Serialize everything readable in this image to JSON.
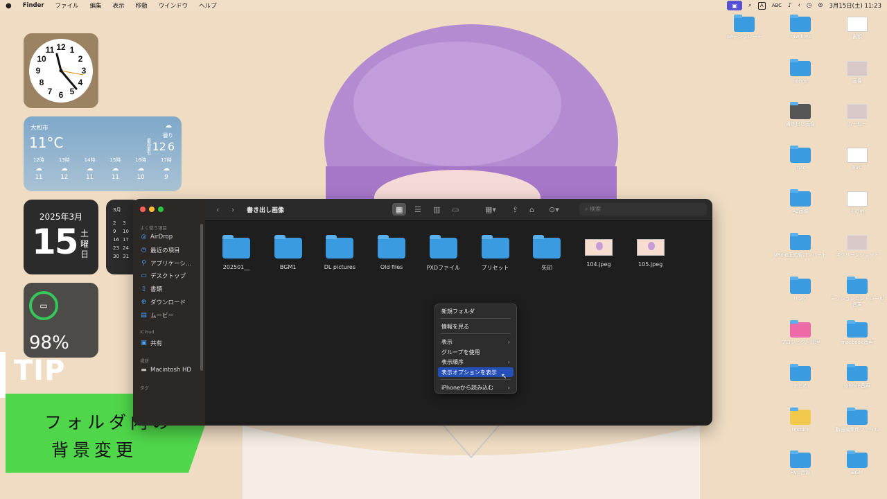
{
  "menubar": {
    "apple": "",
    "items": [
      "Finder",
      "ファイル",
      "編集",
      "表示",
      "移動",
      "ウインドウ",
      "ヘルプ"
    ],
    "input_letter": "A",
    "input_mode": "ABC",
    "datetime": "3月15日(土)  11:23"
  },
  "weather": {
    "city": "大和市",
    "temp": "11°C",
    "condition": "曇り",
    "high_low_label": "最高最低",
    "high": "12",
    "low": "6",
    "hours": [
      {
        "time": "12時",
        "temp": "11"
      },
      {
        "time": "13時",
        "temp": "12"
      },
      {
        "time": "14時",
        "temp": "11"
      },
      {
        "time": "15時",
        "temp": "11"
      },
      {
        "time": "16時",
        "temp": "10"
      },
      {
        "time": "17時",
        "temp": "9"
      }
    ]
  },
  "date_widget": {
    "year_month": "2025年3月",
    "day": "15",
    "weekday": "土曜日"
  },
  "calendar_widget": {
    "month": "3月",
    "days": [
      "2",
      "3",
      "9",
      "10",
      "16",
      "17",
      "23",
      "24",
      "30",
      "31"
    ]
  },
  "battery": {
    "percent": "98%",
    "level": 0.98
  },
  "tip": {
    "label": "TIP",
    "line1": "フォルダ内の",
    "line2": "背景変更"
  },
  "desktop_icons": [
    {
      "label": "Aeテンプレート",
      "kind": "folder"
    },
    {
      "label": "raw files",
      "kind": "folder"
    },
    {
      "label": "書類",
      "kind": "doc"
    },
    {
      "label": "songs",
      "kind": "folder"
    },
    {
      "label": "画像",
      "kind": "image"
    },
    {
      "label": "書き出し画像",
      "kind": "folder-dark"
    },
    {
      "label": "ムービー",
      "kind": "image"
    },
    {
      "label": "mac",
      "kind": "folder"
    },
    {
      "label": "RVC",
      "kind": "doc"
    },
    {
      "label": "AC画像",
      "kind": "folder"
    },
    {
      "label": "その他",
      "kind": "doc"
    },
    {
      "label": "VRoid正式版コンバート",
      "kind": "folder"
    },
    {
      "label": "スクリーンショット",
      "kind": "image"
    },
    {
      "label": "リンク",
      "kind": "folder"
    },
    {
      "label": "ミッションコントロール音声",
      "kind": "folder"
    },
    {
      "label": "プロジェクト管理",
      "kind": "folder-pink"
    },
    {
      "label": "macbook音声",
      "kind": "folder"
    },
    {
      "label": "まとめ",
      "kind": "folder"
    },
    {
      "label": "iphone音声",
      "kind": "folder"
    },
    {
      "label": "texture",
      "kind": "folder-yellow"
    },
    {
      "label": "動画編集用ファイル",
      "kind": "folder"
    },
    {
      "label": "RVC音源",
      "kind": "folder"
    },
    {
      "label": "BGM",
      "kind": "folder"
    }
  ],
  "finder": {
    "title": "書き出し画像",
    "search_placeholder": "検索",
    "sidebar": {
      "favorites_header": "よく使う項目",
      "favorites": [
        {
          "label": "AirDrop",
          "icon": "airdrop-icon"
        },
        {
          "label": "最近の項目",
          "icon": "clock-icon"
        },
        {
          "label": "アプリケーシ…",
          "icon": "apps-icon"
        },
        {
          "label": "デスクトップ",
          "icon": "desktop-icon"
        },
        {
          "label": "書類",
          "icon": "document-icon"
        },
        {
          "label": "ダウンロード",
          "icon": "download-icon"
        },
        {
          "label": "ムービー",
          "icon": "movie-icon"
        }
      ],
      "icloud_header": "iCloud",
      "shared": "共有",
      "locations_header": "場所",
      "macintosh": "Macintosh HD",
      "tags_header": "タグ"
    },
    "files": [
      {
        "name": "202501__",
        "kind": "folder"
      },
      {
        "name": "BGM1",
        "kind": "folder"
      },
      {
        "name": "DL pictures",
        "kind": "folder"
      },
      {
        "name": "Old files",
        "kind": "folder"
      },
      {
        "name": "PXDファイル",
        "kind": "folder"
      },
      {
        "name": "プリセット",
        "kind": "folder"
      },
      {
        "name": "矢印",
        "kind": "folder"
      },
      {
        "name": "104.jpeg",
        "kind": "image"
      },
      {
        "name": "105.jpeg",
        "kind": "image"
      }
    ]
  },
  "context_menu": {
    "items": [
      {
        "label": "新規フォルダ"
      },
      {
        "label": "情報を見る"
      },
      {
        "label": "表示",
        "submenu": true
      },
      {
        "label": "グループを使用"
      },
      {
        "label": "表示順序",
        "submenu": true
      },
      {
        "label": "表示オプションを表示",
        "selected": true
      },
      {
        "label": "iPhoneから読み込む",
        "submenu": true
      }
    ]
  }
}
